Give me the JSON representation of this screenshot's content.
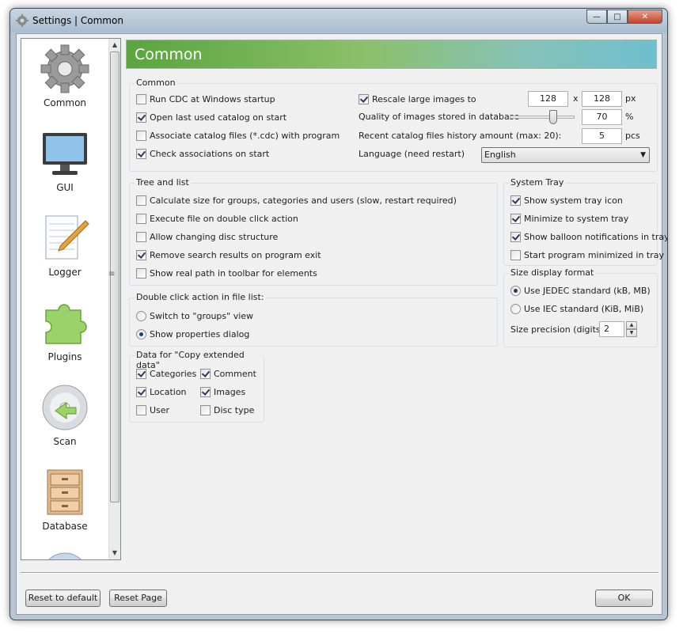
{
  "window": {
    "title": "Settings | Common",
    "controls": {
      "minimize": "—",
      "maximize": "□",
      "close": "✕"
    }
  },
  "sidebar": {
    "items": [
      {
        "label": "Common",
        "icon": "gear-icon"
      },
      {
        "label": "GUI",
        "icon": "monitor-icon"
      },
      {
        "label": "Logger",
        "icon": "notepad-pencil-icon"
      },
      {
        "label": "Plugins",
        "icon": "puzzle-icon"
      },
      {
        "label": "Scan",
        "icon": "disc-icon"
      },
      {
        "label": "Database",
        "icon": "cabinet-icon"
      }
    ],
    "grip": "≡"
  },
  "banner": {
    "title": "Common"
  },
  "common": {
    "title": "Common",
    "run_cdc": {
      "label": "Run CDC at Windows startup",
      "checked": false
    },
    "open_last": {
      "label": "Open last used catalog on start",
      "checked": true
    },
    "associate": {
      "label": "Associate catalog files (*.cdc) with program",
      "checked": false
    },
    "check_assoc": {
      "label": "Check associations on start",
      "checked": true
    },
    "rescale": {
      "label": "Rescale large images to",
      "checked": true,
      "width": "128",
      "height": "128",
      "x": "x",
      "unit": "px"
    },
    "quality": {
      "label": "Quality of images stored in database",
      "value": "70",
      "unit": "%",
      "level": 0.7
    },
    "recent": {
      "label": "Recent catalog files history amount (max: 20):",
      "value": "5",
      "unit": "pcs"
    },
    "language": {
      "label": "Language (need restart)",
      "value": "English",
      "arrow": "▼"
    }
  },
  "tree": {
    "title": "Tree and list",
    "items": [
      {
        "label": "Calculate size for groups, categories and users (slow, restart required)",
        "checked": false
      },
      {
        "label": "Execute file on double click action",
        "checked": false
      },
      {
        "label": "Allow changing disc structure",
        "checked": false
      },
      {
        "label": "Remove search results on program exit",
        "checked": true
      },
      {
        "label": "Show real path in toolbar for elements",
        "checked": false
      }
    ]
  },
  "tray": {
    "title": "System Tray",
    "items": [
      {
        "label": "Show system tray icon",
        "checked": true
      },
      {
        "label": "Minimize to system tray",
        "checked": true
      },
      {
        "label": "Show balloon notifications in tray",
        "checked": true
      },
      {
        "label": "Start program minimized in tray",
        "checked": false
      }
    ]
  },
  "dblclick": {
    "title": "Double click action in file list:",
    "items": [
      {
        "label": "Switch to \"groups\" view",
        "selected": false
      },
      {
        "label": "Show properties dialog",
        "selected": true
      }
    ]
  },
  "sizefmt": {
    "title": "Size display format",
    "items": [
      {
        "label": "Use JEDEC standard (kB, MB)",
        "selected": true
      },
      {
        "label": "Use IEC standard (KiB, MiB)",
        "selected": false
      }
    ],
    "precision_label": "Size precision (digits)",
    "precision_value": "2",
    "up": "▲",
    "down": "▼"
  },
  "copydata": {
    "title": "Data for \"Copy extended data\"",
    "items": [
      {
        "label": "Categories",
        "checked": true
      },
      {
        "label": "Comment",
        "checked": true
      },
      {
        "label": "Location",
        "checked": true
      },
      {
        "label": "Images",
        "checked": true
      },
      {
        "label": "User",
        "checked": false
      },
      {
        "label": "Disc type",
        "checked": false
      }
    ]
  },
  "buttons": {
    "reset_default": "Reset to default",
    "reset_page": "Reset Page",
    "ok": "OK"
  },
  "colors": {
    "banner_start": "#5aa53e",
    "banner_end": "#6fbfcf",
    "window_frame": "#b9c6d2",
    "close_button": "#c4432a"
  }
}
